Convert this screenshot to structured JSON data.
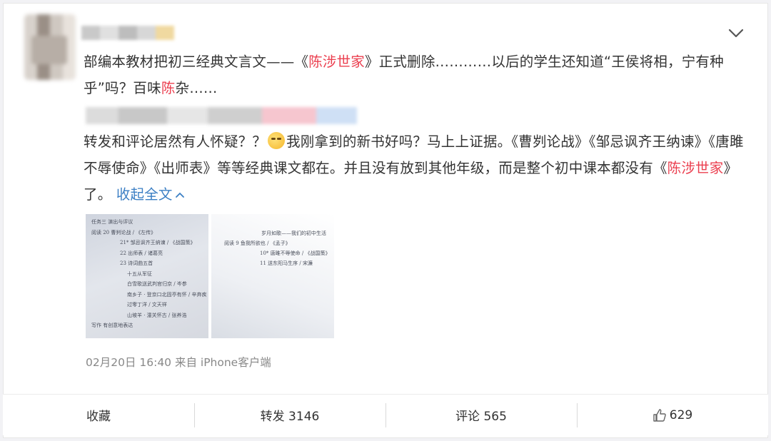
{
  "post": {
    "paragraph1": {
      "part1": "部编本教材把初三经典文言文——《",
      "highlight1": "陈涉世家",
      "part2": "》正式删除…………以后的学生还知道“王侯将相，宁有种乎”吗？百味",
      "highlight2": "陈",
      "part3": "杂……"
    },
    "paragraph2": {
      "part1": "转发和评论居然有人怀疑？？",
      "emoji": "thinking-emoji",
      "part2": "我刚拿到的新书好吗？马上上证据。《曹刿论战》《邹忌讽齐王纳谏》《唐雎不辱使命》《出师表》等等经典课文都在。并且没有放到其他年级，而是整个初中课本都没有《",
      "highlight": "陈涉世家",
      "part3": "》了。",
      "collapse_link": "收起全文",
      "collapse_icon": "chevron-up-icon"
    },
    "photo1": {
      "lines": [
        "任务三   演出与评议",
        "阅读     20  曹刿论战 / 《左传》",
        "21*  邹忌讽齐王纳谏 / 《战国策》",
        "22  出师表 / 诸葛亮",
        "23  诗词曲五首",
        "十五从军征",
        "白雪歌送武判官归京 / 岑参",
        "南乡子 · 登京口北固亭有怀 / 辛弃疾",
        "过零丁洋 / 文天祥",
        "山坡羊 · 潼关怀古 / 张养浩",
        "写作     有创意地表达"
      ]
    },
    "photo2": {
      "lines": [
        "岁月如歌——我们的初中生活",
        "阅读     9  鱼我所欲也 / 《孟子》",
        "10*  唐雎不辱使命 / 《战国策》",
        "11  送东阳马生序 / 宋濂"
      ]
    },
    "meta": "02月20日 16:40 来自 iPhone客户端",
    "more_icon": "chevron-down-icon"
  },
  "actions": {
    "favorite": "收藏",
    "repost": "转发 3146",
    "comment": "评论 565",
    "like_count": "629",
    "like_icon": "thumbs-up-icon"
  },
  "colors": {
    "highlight": "#eb3f4f",
    "link": "#3b7fc4",
    "meta": "#888888"
  }
}
